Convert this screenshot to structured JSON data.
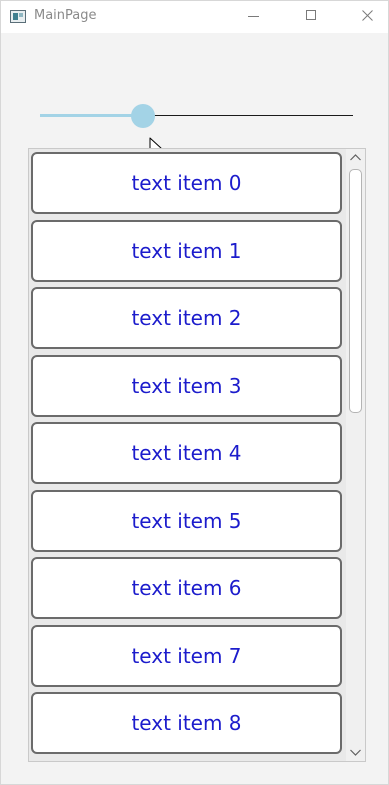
{
  "window": {
    "title": "MainPage",
    "icons": {
      "app": "app-window-icon",
      "minimize": "minimize-icon",
      "maximize": "maximize-icon",
      "close": "close-icon"
    }
  },
  "slider": {
    "value_fraction": 0.33,
    "fill_color": "#a3d3e6",
    "thumb_color": "#a3d3e6",
    "track_color": "#1a1a1a"
  },
  "list": {
    "items": [
      "text item 0",
      "text item 1",
      "text item 2",
      "text item 3",
      "text item 4",
      "text item 5",
      "text item 6",
      "text item 7",
      "text item 8"
    ],
    "text_color": "#1c1ccc",
    "border_color": "#6b6b6b"
  },
  "scrollbar": {
    "icons": {
      "up": "chevron-up-icon",
      "down": "chevron-down-icon"
    },
    "visible_fraction": 0.43
  }
}
